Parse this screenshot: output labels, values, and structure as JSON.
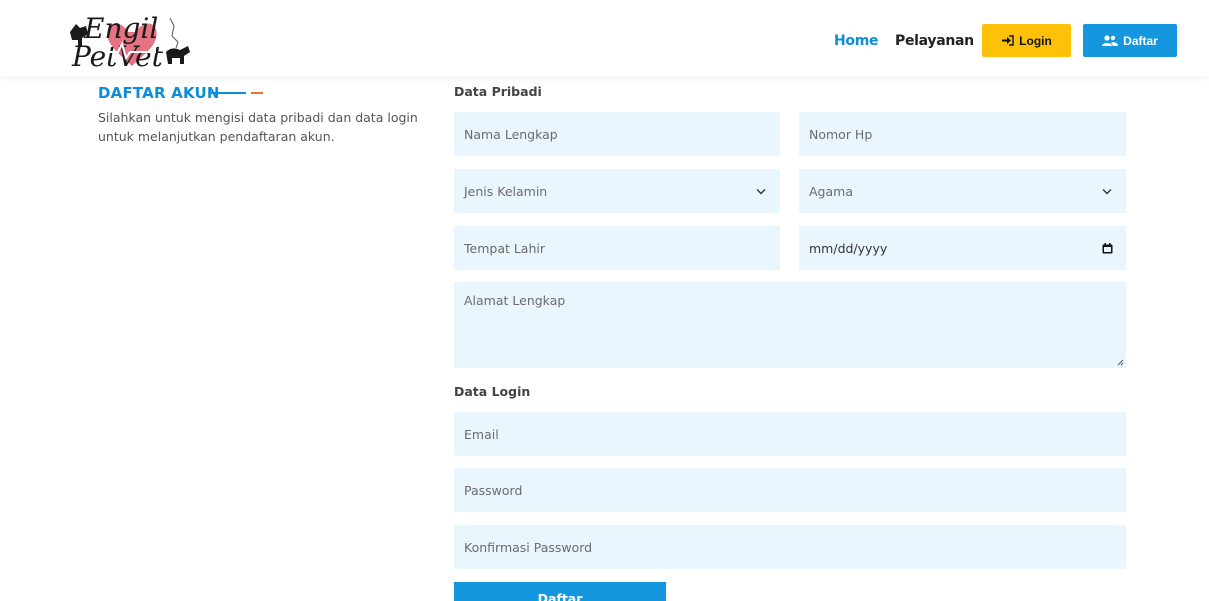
{
  "brand": {
    "logo_line1": "Engil",
    "logo_line2": "PetVet",
    "colors": {
      "heart": "#e05a6b",
      "ink": "#1a1a1a"
    }
  },
  "nav": {
    "home": "Home",
    "services": "Pelayanan",
    "login": "Login",
    "register": "Daftar",
    "icons": {
      "login": "sign-in-icon",
      "register": "users-icon"
    },
    "colors": {
      "active": "#0d8dd9",
      "login_bg": "#ffc107",
      "register_bg": "#1597e0"
    }
  },
  "intro": {
    "title": "DAFTAR AKUN",
    "description": "Silahkan untuk mengisi data pribadi dan data login untuk melanjutkan pendaftaran akun."
  },
  "personal": {
    "label": "Data Pribadi",
    "full_name": "Nama Lengkap",
    "phone": "Nomor Hp",
    "gender": "Jenis Kelamin",
    "religion": "Agama",
    "birthplace": "Tempat Lahir",
    "birthdate": "mm/dd/yyyy",
    "address": "Alamat Lengkap"
  },
  "login_data": {
    "label": "Data Login",
    "email": "Email",
    "password": "Password",
    "confirm_password": "Konfirmasi Password"
  },
  "submit": "Daftar",
  "colors": {
    "field_bg": "#eaf6fe",
    "accent_blue": "#0d8dd9",
    "accent_orange": "#f06f3e"
  }
}
